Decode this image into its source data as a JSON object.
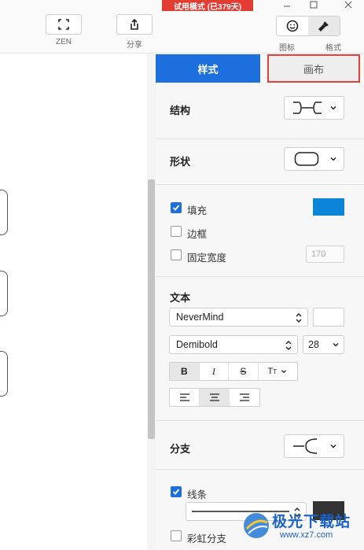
{
  "toolbar": {
    "zen_label": "ZEN",
    "share_label": "分享",
    "trial_badge": "试用模式 (已379天)",
    "icon_tab_label": "图标",
    "format_tab_label": "格式"
  },
  "panel": {
    "tabs": {
      "style": "样式",
      "canvas": "画布"
    },
    "structure": {
      "title": "结构"
    },
    "shape": {
      "title": "形状"
    },
    "fill": {
      "label": "填充",
      "checked": true,
      "color": "#0a84d6"
    },
    "border": {
      "label": "边框",
      "checked": false
    },
    "fixed_width": {
      "label": "固定宽度",
      "checked": false,
      "value": "170"
    },
    "text": {
      "title": "文本",
      "font_family": "NeverMind",
      "font_weight": "Demibold",
      "font_size": "28",
      "color": "#ffffff"
    },
    "branch": {
      "title": "分支"
    },
    "line": {
      "label": "线条",
      "checked": true,
      "color": "#333333"
    },
    "rainbow": {
      "label": "彩虹分支",
      "checked": false
    }
  },
  "colors": {
    "accent": "#1d6fde",
    "highlight": "#e0433d",
    "trial": "#e23c33"
  },
  "watermark": {
    "brand": "极光下载站",
    "url": "www.xz7.com"
  }
}
